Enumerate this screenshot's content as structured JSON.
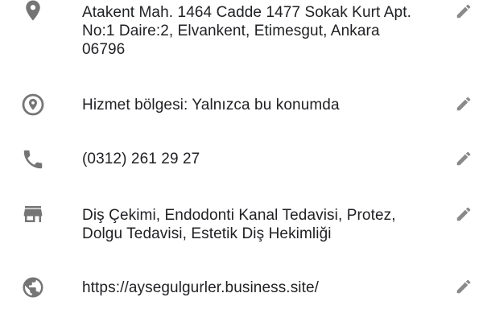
{
  "colors": {
    "icon": "#757575",
    "edit_icon": "#8a8a8a",
    "text": "#202124",
    "background": "#ffffff"
  },
  "rows": [
    {
      "icon": "location-pin-icon",
      "lines": [
        "Atakent Mah. 1464 Cadde 1477 Sokak Kurt Apt.",
        "No:1 Daire:2, Elvankent, Etimesgut, Ankara",
        "06796"
      ],
      "action_icon": "pencil-edit-icon"
    },
    {
      "icon": "service-area-icon",
      "lines": [
        "Hizmet bölgesi: Yalnızca bu konumda"
      ],
      "action_icon": "pencil-edit-icon"
    },
    {
      "icon": "phone-icon",
      "lines": [
        "(0312) 261 29 27"
      ],
      "action_icon": "pencil-edit-icon"
    },
    {
      "icon": "storefront-icon",
      "lines": [
        "Diş Çekimi, Endodonti Kanal Tedavisi, Protez,",
        "Dolgu Tedavisi, Estetik Diş Hekimliği"
      ],
      "action_icon": "pencil-edit-icon"
    },
    {
      "icon": "globe-icon",
      "lines": [
        "https://aysegulgurler.business.site/"
      ],
      "action_icon": "pencil-edit-icon"
    }
  ]
}
